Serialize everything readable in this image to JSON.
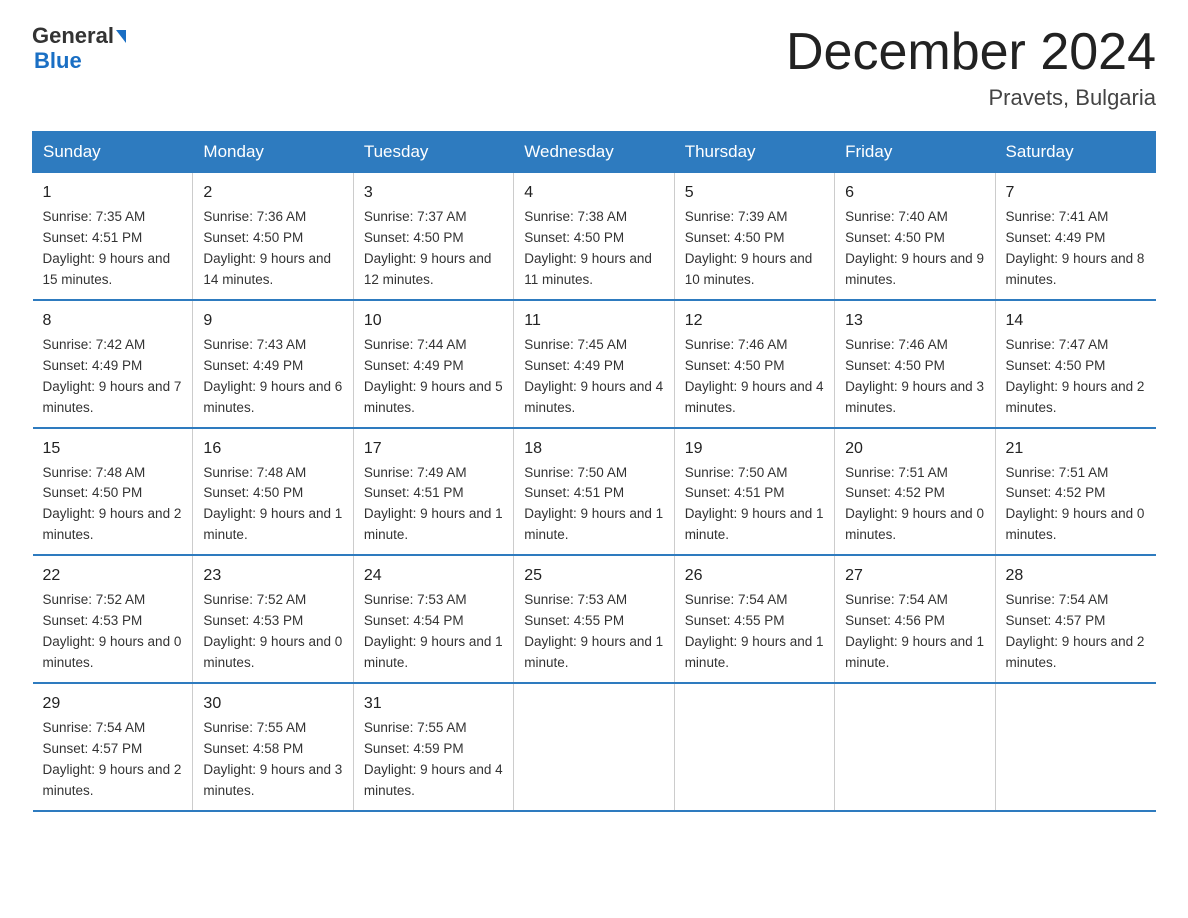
{
  "header": {
    "logo_line1": "General",
    "logo_line2": "Blue",
    "month_title": "December 2024",
    "location": "Pravets, Bulgaria"
  },
  "days_of_week": [
    "Sunday",
    "Monday",
    "Tuesday",
    "Wednesday",
    "Thursday",
    "Friday",
    "Saturday"
  ],
  "weeks": [
    [
      {
        "day": "1",
        "sunrise": "7:35 AM",
        "sunset": "4:51 PM",
        "daylight": "9 hours and 15 minutes."
      },
      {
        "day": "2",
        "sunrise": "7:36 AM",
        "sunset": "4:50 PM",
        "daylight": "9 hours and 14 minutes."
      },
      {
        "day": "3",
        "sunrise": "7:37 AM",
        "sunset": "4:50 PM",
        "daylight": "9 hours and 12 minutes."
      },
      {
        "day": "4",
        "sunrise": "7:38 AM",
        "sunset": "4:50 PM",
        "daylight": "9 hours and 11 minutes."
      },
      {
        "day": "5",
        "sunrise": "7:39 AM",
        "sunset": "4:50 PM",
        "daylight": "9 hours and 10 minutes."
      },
      {
        "day": "6",
        "sunrise": "7:40 AM",
        "sunset": "4:50 PM",
        "daylight": "9 hours and 9 minutes."
      },
      {
        "day": "7",
        "sunrise": "7:41 AM",
        "sunset": "4:49 PM",
        "daylight": "9 hours and 8 minutes."
      }
    ],
    [
      {
        "day": "8",
        "sunrise": "7:42 AM",
        "sunset": "4:49 PM",
        "daylight": "9 hours and 7 minutes."
      },
      {
        "day": "9",
        "sunrise": "7:43 AM",
        "sunset": "4:49 PM",
        "daylight": "9 hours and 6 minutes."
      },
      {
        "day": "10",
        "sunrise": "7:44 AM",
        "sunset": "4:49 PM",
        "daylight": "9 hours and 5 minutes."
      },
      {
        "day": "11",
        "sunrise": "7:45 AM",
        "sunset": "4:49 PM",
        "daylight": "9 hours and 4 minutes."
      },
      {
        "day": "12",
        "sunrise": "7:46 AM",
        "sunset": "4:50 PM",
        "daylight": "9 hours and 4 minutes."
      },
      {
        "day": "13",
        "sunrise": "7:46 AM",
        "sunset": "4:50 PM",
        "daylight": "9 hours and 3 minutes."
      },
      {
        "day": "14",
        "sunrise": "7:47 AM",
        "sunset": "4:50 PM",
        "daylight": "9 hours and 2 minutes."
      }
    ],
    [
      {
        "day": "15",
        "sunrise": "7:48 AM",
        "sunset": "4:50 PM",
        "daylight": "9 hours and 2 minutes."
      },
      {
        "day": "16",
        "sunrise": "7:48 AM",
        "sunset": "4:50 PM",
        "daylight": "9 hours and 1 minute."
      },
      {
        "day": "17",
        "sunrise": "7:49 AM",
        "sunset": "4:51 PM",
        "daylight": "9 hours and 1 minute."
      },
      {
        "day": "18",
        "sunrise": "7:50 AM",
        "sunset": "4:51 PM",
        "daylight": "9 hours and 1 minute."
      },
      {
        "day": "19",
        "sunrise": "7:50 AM",
        "sunset": "4:51 PM",
        "daylight": "9 hours and 1 minute."
      },
      {
        "day": "20",
        "sunrise": "7:51 AM",
        "sunset": "4:52 PM",
        "daylight": "9 hours and 0 minutes."
      },
      {
        "day": "21",
        "sunrise": "7:51 AM",
        "sunset": "4:52 PM",
        "daylight": "9 hours and 0 minutes."
      }
    ],
    [
      {
        "day": "22",
        "sunrise": "7:52 AM",
        "sunset": "4:53 PM",
        "daylight": "9 hours and 0 minutes."
      },
      {
        "day": "23",
        "sunrise": "7:52 AM",
        "sunset": "4:53 PM",
        "daylight": "9 hours and 0 minutes."
      },
      {
        "day": "24",
        "sunrise": "7:53 AM",
        "sunset": "4:54 PM",
        "daylight": "9 hours and 1 minute."
      },
      {
        "day": "25",
        "sunrise": "7:53 AM",
        "sunset": "4:55 PM",
        "daylight": "9 hours and 1 minute."
      },
      {
        "day": "26",
        "sunrise": "7:54 AM",
        "sunset": "4:55 PM",
        "daylight": "9 hours and 1 minute."
      },
      {
        "day": "27",
        "sunrise": "7:54 AM",
        "sunset": "4:56 PM",
        "daylight": "9 hours and 1 minute."
      },
      {
        "day": "28",
        "sunrise": "7:54 AM",
        "sunset": "4:57 PM",
        "daylight": "9 hours and 2 minutes."
      }
    ],
    [
      {
        "day": "29",
        "sunrise": "7:54 AM",
        "sunset": "4:57 PM",
        "daylight": "9 hours and 2 minutes."
      },
      {
        "day": "30",
        "sunrise": "7:55 AM",
        "sunset": "4:58 PM",
        "daylight": "9 hours and 3 minutes."
      },
      {
        "day": "31",
        "sunrise": "7:55 AM",
        "sunset": "4:59 PM",
        "daylight": "9 hours and 4 minutes."
      },
      null,
      null,
      null,
      null
    ]
  ]
}
